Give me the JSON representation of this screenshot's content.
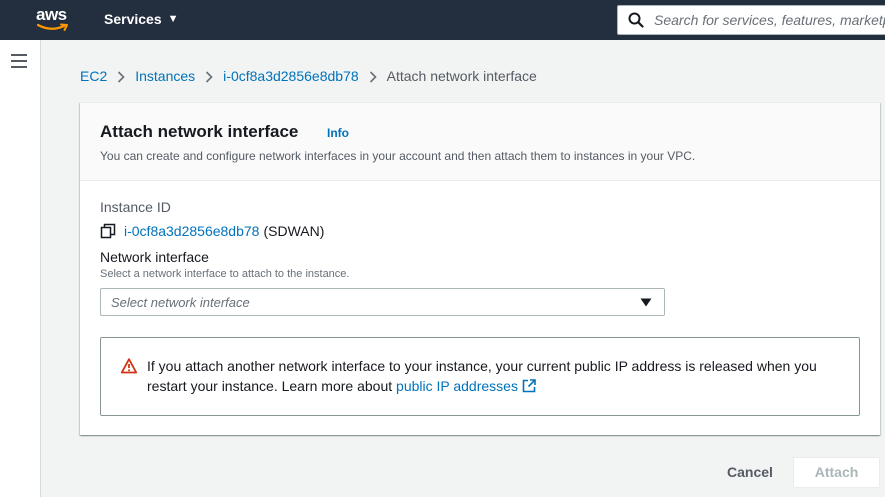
{
  "topnav": {
    "logo_text": "aws",
    "services_label": "Services",
    "search_placeholder": "Search for services, features, marketplace products, and docs"
  },
  "breadcrumb": {
    "items": [
      "EC2",
      "Instances",
      "i-0cf8a3d2856e8db78"
    ],
    "current": "Attach network interface"
  },
  "card": {
    "title": "Attach network interface",
    "info_label": "Info",
    "description": "You can create and configure network interfaces in your account and then attach them to instances in your VPC.",
    "instance_id_label": "Instance ID",
    "instance_id_value": "i-0cf8a3d2856e8db78",
    "instance_name": "(SDWAN)",
    "network_interface_label": "Network interface",
    "network_interface_desc": "Select a network interface to attach to the instance.",
    "select_placeholder": "Select network interface",
    "alert_text": "If you attach another network interface to your instance, your current public IP address is released when you restart your instance. Learn more about ",
    "alert_link": "public IP addresses"
  },
  "footer": {
    "cancel_label": "Cancel",
    "attach_label": "Attach"
  },
  "colors": {
    "nav_bg": "#232f3e",
    "link": "#0073bb",
    "warning": "#d13212",
    "smile": "#ff9900"
  }
}
